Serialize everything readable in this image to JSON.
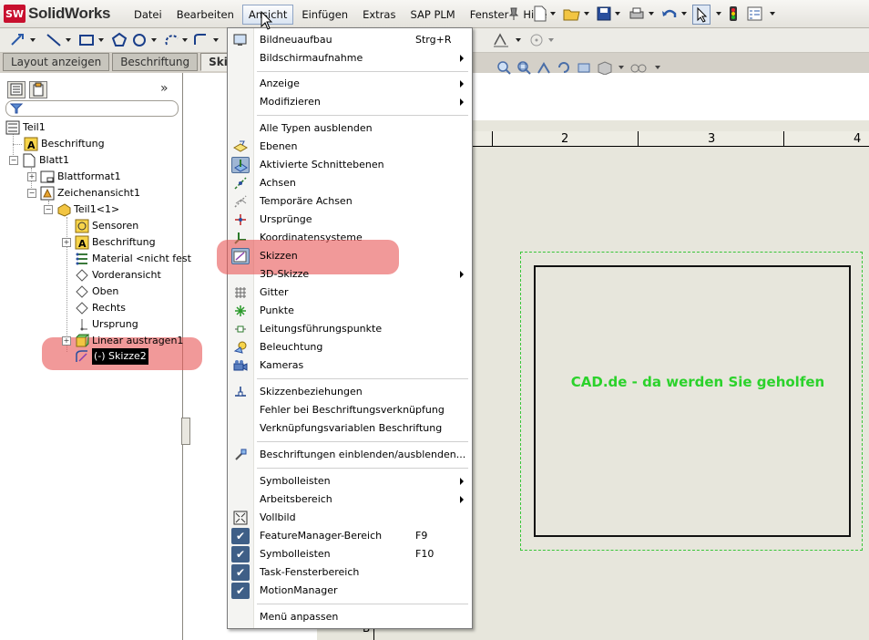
{
  "app": {
    "logo_badge": "SW",
    "name": "SolidWorks"
  },
  "menubar": [
    "Datei",
    "Bearbeiten",
    "Ansicht",
    "Einfügen",
    "Extras",
    "SAP PLM",
    "Fenster",
    "Hilfe"
  ],
  "active_menu": "Ansicht",
  "panel_tabs": [
    "Layout anzeigen",
    "Beschriftung",
    "Skizze"
  ],
  "feature_tree": {
    "expand_label": "»",
    "items": [
      {
        "label": "Teil1",
        "icon": "part-icon"
      },
      {
        "label": "Beschriftung",
        "icon": "annotation-icon"
      },
      {
        "label": "Blatt1",
        "icon": "sheet-icon"
      },
      {
        "label": "Blattformat1",
        "icon": "sheet-format-icon"
      },
      {
        "label": "Zeichenansicht1",
        "icon": "drawing-view-icon"
      },
      {
        "label": "Teil1<1>",
        "icon": "part-icon"
      },
      {
        "label": "Sensoren",
        "icon": "sensor-icon"
      },
      {
        "label": "Beschriftung",
        "icon": "annotation-icon"
      },
      {
        "label": "Material <nicht fest",
        "icon": "material-icon"
      },
      {
        "label": "Vorderansicht",
        "icon": "plane-icon"
      },
      {
        "label": "Oben",
        "icon": "plane-icon"
      },
      {
        "label": "Rechts",
        "icon": "plane-icon"
      },
      {
        "label": "Ursprung",
        "icon": "origin-icon"
      },
      {
        "label": "Linear austragen1",
        "icon": "extrude-icon"
      },
      {
        "label": "(-) Skizze2",
        "icon": "sketch-icon"
      }
    ]
  },
  "view_menu": {
    "items": [
      {
        "label": "Bildneuaufbau",
        "shortcut": "Strg+R",
        "icon": "redraw-icon"
      },
      {
        "label": "Bildschirmaufnahme",
        "submenu": true
      },
      {
        "label": "Anzeige",
        "submenu": true
      },
      {
        "label": "Modifizieren",
        "submenu": true
      },
      {
        "label": "Alle Typen ausblenden"
      },
      {
        "label": "Ebenen",
        "icon": "plane-icon"
      },
      {
        "label": "Aktivierte Schnittebenen",
        "icon": "section-plane-icon",
        "toggled": true
      },
      {
        "label": "Achsen",
        "icon": "axis-icon"
      },
      {
        "label": "Temporäre Achsen",
        "icon": "temp-axis-icon"
      },
      {
        "label": "Ursprünge",
        "icon": "origin-icon"
      },
      {
        "label": "Koordinatensysteme",
        "icon": "coordinate-system-icon"
      },
      {
        "label": "Skizzen",
        "icon": "sketch-icon",
        "toggled": true
      },
      {
        "label": "3D-Skizze",
        "submenu": true
      },
      {
        "label": "Gitter",
        "icon": "grid-icon"
      },
      {
        "label": "Punkte",
        "icon": "point-icon"
      },
      {
        "label": "Leitungsführungspunkte",
        "icon": "routing-point-icon"
      },
      {
        "label": "Beleuchtung",
        "icon": "light-icon"
      },
      {
        "label": "Kameras",
        "icon": "camera-icon"
      },
      {
        "label": "Skizzenbeziehungen",
        "icon": "sketch-relations-icon"
      },
      {
        "label": "Fehler bei Beschriftungsverknüpfung"
      },
      {
        "label": "Verknüpfungsvariablen Beschriftung"
      },
      {
        "label": "Beschriftungen einblenden/ausblenden...",
        "icon": "annotation-toggle-icon"
      },
      {
        "label": "Symbolleisten",
        "submenu": true
      },
      {
        "label": "Arbeitsbereich",
        "submenu": true
      },
      {
        "label": "Vollbild",
        "icon": "fullscreen-icon"
      },
      {
        "label": "FeatureManager-Bereich",
        "shortcut": "F9",
        "checked": true
      },
      {
        "label": "Symbolleisten",
        "shortcut": "F10",
        "checked": true
      },
      {
        "label": "Task-Fensterbereich",
        "checked": true
      },
      {
        "label": "MotionManager",
        "checked": true
      },
      {
        "label": "Menü anpassen"
      }
    ]
  },
  "sheet": {
    "ruler_labels": [
      "2",
      "3",
      "4"
    ],
    "border_letter": "B",
    "watermark_text": "CAD.de - da werden Sie geholfen",
    "watermark_color": "#2bd22b"
  },
  "colors": {
    "highlight": "#e85a5a",
    "menu_active": "#d9e4f2",
    "check_bg": "#3f5f87"
  }
}
